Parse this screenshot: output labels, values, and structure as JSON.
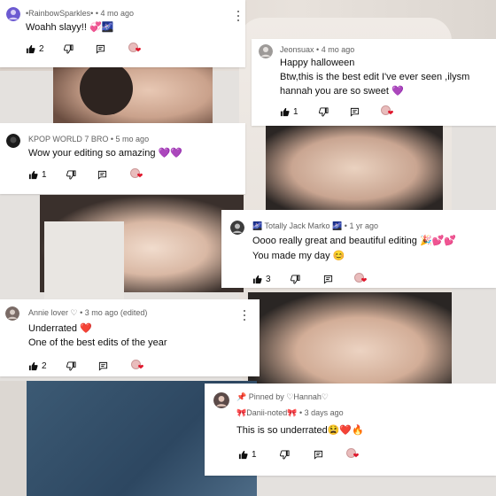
{
  "comments": [
    {
      "author": "•RainbowSparkles•",
      "time": "4 mo ago",
      "text": "Woahh slayy!! 💞🌌",
      "likes": "2",
      "avatar_color": "#6c5ad1"
    },
    {
      "author": "Jeonsuax",
      "time": "4 mo ago",
      "line1": "Happy halloween",
      "line2": "Btw,this is the best edit I've ever seen ,ilysm",
      "line3": "hannah you are so sweet 💜",
      "likes": "1",
      "avatar_color": "#9d9a98"
    },
    {
      "author": "KPOP WORLD 7 BRO",
      "time": "5 mo ago",
      "text": "Wow your editing so amazing 💜💜",
      "likes": "1",
      "avatar_color": "#1b1b1b"
    },
    {
      "author": "🌌 Totally Jack Marko 🌌",
      "time": "1 yr ago",
      "line1": "Oooo really great and beautiful editing 🎉💕💕",
      "line2": "You made my day 😊",
      "likes": "3",
      "avatar_color": "#3d3d3d"
    },
    {
      "author": "Annie lover ♡",
      "time": "3 mo ago (edited)",
      "line1": "Underrated ❤️",
      "line2": "One of the best edits of the year",
      "likes": "2",
      "avatar_color": "#7a6b66"
    },
    {
      "pinned_label": "Pinned by ♡Hannah♡",
      "author": "🎀Danii-noted🎀",
      "time": "3 days ago",
      "text": "This is so underrated😫❤️🔥",
      "likes": "1",
      "avatar_color": "#5b4a48"
    }
  ],
  "separator": "•",
  "colors": {
    "heart": "#e0162b",
    "meta_text": "#606060",
    "card_bg": "#ffffff"
  },
  "icons": [
    "thumbs-up-icon",
    "thumbs-down-icon",
    "reply-icon",
    "creator-heart-icon",
    "more-vert-icon",
    "pin-icon"
  ]
}
